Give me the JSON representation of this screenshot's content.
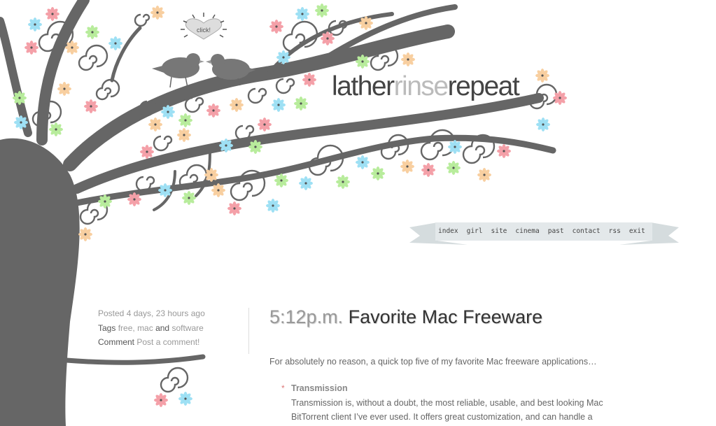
{
  "logo": {
    "part1": "lather",
    "part2": "rinse",
    "part3": "repeat"
  },
  "click_badge": "click!",
  "nav": [
    "index",
    "girl",
    "site",
    "cinema",
    "past",
    "contact",
    "rss",
    "exit"
  ],
  "meta": {
    "posted_label": "Posted",
    "posted_value": "4 days, 23 hours ago",
    "tags_label": "Tags",
    "tag1": "free",
    "tag2": "mac",
    "tags_and": "and",
    "tag3": "software",
    "comment_label": "Comment",
    "comment_link": "Post a comment!"
  },
  "post": {
    "time": "5:12p.m.",
    "title": "Favorite Mac Freeware",
    "intro": "For absolutely no reason, a quick top five of my favorite Mac freeware applications…",
    "items": [
      {
        "bullet": "*",
        "name": "Transmission",
        "line1": "Transmission is, without a doubt, the most reliable, usable, and best looking Mac",
        "line2": "BitTorrent client I’ve ever used. It offers great customization, and can handle a"
      }
    ]
  },
  "colors": {
    "tree": "#666666",
    "pink": "#f4a0a8",
    "blue": "#9ee0f4",
    "green": "#b8ec9c",
    "peach": "#f8cfa0",
    "ribbon": "#d3dadd"
  }
}
